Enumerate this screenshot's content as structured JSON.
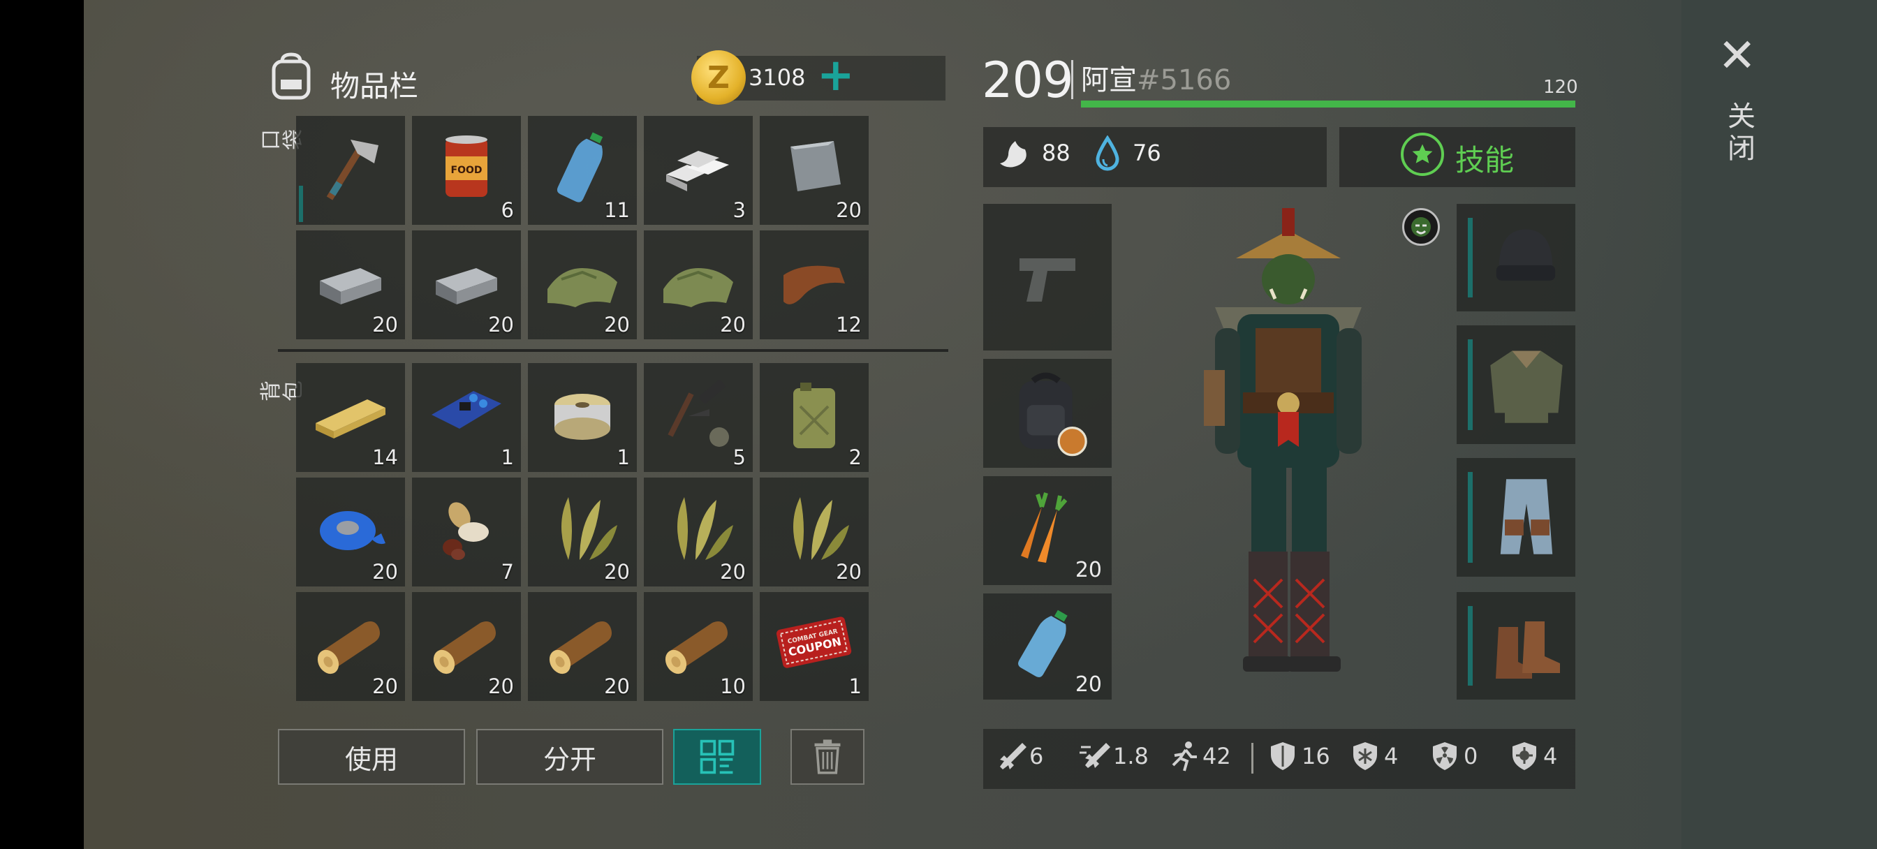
{
  "header": {
    "title": "物品栏",
    "coins": "3108",
    "coin_symbol": "Z",
    "add_symbol": "+"
  },
  "player": {
    "level": "209",
    "name": "阿宣",
    "tag": "#5166",
    "hp_max": "120",
    "hp_fraction": 1.0
  },
  "needs": {
    "hunger": "88",
    "thirst": "76"
  },
  "skills_label": "技能",
  "close": {
    "icon": "✕",
    "label": "关闭"
  },
  "sections": {
    "pockets": "口袋",
    "backpack": "背包"
  },
  "pockets": [
    {
      "name": "hatchet",
      "qty": ""
    },
    {
      "name": "canned-food",
      "qty": "6",
      "label": "FOOD"
    },
    {
      "name": "water-bottle",
      "qty": "11"
    },
    {
      "name": "aluminum-bars",
      "qty": "3"
    },
    {
      "name": "metal-plate",
      "qty": "20"
    },
    {
      "name": "iron-ingot",
      "qty": "20"
    },
    {
      "name": "iron-ingot",
      "qty": "20"
    },
    {
      "name": "cloth",
      "qty": "20"
    },
    {
      "name": "cloth",
      "qty": "20"
    },
    {
      "name": "leather",
      "qty": "12"
    }
  ],
  "backpack": [
    {
      "name": "wood-plank",
      "qty": "14"
    },
    {
      "name": "circuit-board",
      "qty": "1"
    },
    {
      "name": "wire-spool",
      "qty": "1"
    },
    {
      "name": "gun-parts",
      "qty": "5"
    },
    {
      "name": "jerry-can",
      "qty": "2"
    },
    {
      "name": "duct-tape",
      "qty": "20"
    },
    {
      "name": "seeds",
      "qty": "7"
    },
    {
      "name": "plant-fiber",
      "qty": "20"
    },
    {
      "name": "plant-fiber",
      "qty": "20"
    },
    {
      "name": "plant-fiber",
      "qty": "20"
    },
    {
      "name": "log",
      "qty": "20"
    },
    {
      "name": "log",
      "qty": "20"
    },
    {
      "name": "log",
      "qty": "20"
    },
    {
      "name": "log",
      "qty": "10"
    },
    {
      "name": "coupon",
      "qty": "1",
      "label_top": "COMBAT GEAR",
      "label_main": "COUPON"
    }
  ],
  "buttons": {
    "use": "使用",
    "split": "分开"
  },
  "quick_slots": [
    {
      "name": "weapon-empty",
      "qty": ""
    },
    {
      "name": "backpack",
      "qty": ""
    },
    {
      "name": "carrots",
      "qty": "20"
    },
    {
      "name": "water-bottle",
      "qty": "20"
    }
  ],
  "armor_slots": [
    "beanie",
    "jacket",
    "pants",
    "boots"
  ],
  "stats": {
    "melee_damage": "6",
    "attack_speed": "1.8",
    "movement": "42",
    "armor": "16",
    "cold_resist": "4",
    "radiation": "0",
    "infection": "4"
  },
  "colors": {
    "accent": "#1aa39a",
    "health": "#43b649",
    "skills": "#5fce52",
    "coin": "#e4b22a"
  }
}
